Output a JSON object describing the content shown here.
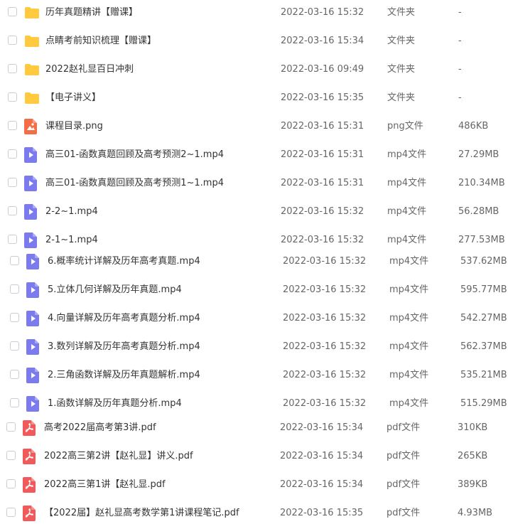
{
  "colors": {
    "folder": "#FFC940",
    "image_file": "#F36E47",
    "video_file": "#7B7BEF",
    "pdf_file": "#F05A5A",
    "checkbox_border": "#C9CDD4",
    "text_primary": "#333333",
    "text_secondary": "#666666"
  },
  "files": [
    {
      "icon": "folder-icon",
      "name": "历年真题精讲【赠课】",
      "date": "2022-03-16 15:32",
      "type": "文件夹",
      "size": "-"
    },
    {
      "icon": "folder-icon",
      "name": "点睛考前知识梳理【赠课】",
      "date": "2022-03-16 15:34",
      "type": "文件夹",
      "size": "-"
    },
    {
      "icon": "folder-icon",
      "name": "2022赵礼显百日冲刺",
      "date": "2022-03-16 09:49",
      "type": "文件夹",
      "size": "-"
    },
    {
      "icon": "folder-icon",
      "name": "【电子讲义】",
      "date": "2022-03-16 15:35",
      "type": "文件夹",
      "size": "-"
    },
    {
      "icon": "image-file-icon",
      "name": "课程目录.png",
      "date": "2022-03-16 15:31",
      "type": "png文件",
      "size": "486KB"
    },
    {
      "icon": "video-file-icon",
      "name": "高三01-函数真题回顾及高考预测2~1.mp4",
      "date": "2022-03-16 15:31",
      "type": "mp4文件",
      "size": "27.29MB"
    },
    {
      "icon": "video-file-icon",
      "name": "高三01-函数真题回顾及高考预测1~1.mp4",
      "date": "2022-03-16 15:31",
      "type": "mp4文件",
      "size": "210.34MB"
    },
    {
      "icon": "video-file-icon",
      "name": "2-2~1.mp4",
      "date": "2022-03-16 15:32",
      "type": "mp4文件",
      "size": "56.28MB"
    },
    {
      "icon": "video-file-icon",
      "name": "2-1~1.mp4",
      "date": "2022-03-16 15:32",
      "type": "mp4文件",
      "size": "277.53MB"
    },
    {
      "icon": "video-file-icon",
      "name": "6.概率统计详解及历年高考真题.mp4",
      "date": "2022-03-16 15:32",
      "type": "mp4文件",
      "size": "537.62MB"
    },
    {
      "icon": "video-file-icon",
      "name": "5.立体几何详解及历年真题.mp4",
      "date": "2022-03-16 15:32",
      "type": "mp4文件",
      "size": "595.77MB"
    },
    {
      "icon": "video-file-icon",
      "name": "4.向量详解及历年高考真题分析.mp4",
      "date": "2022-03-16 15:32",
      "type": "mp4文件",
      "size": "542.27MB"
    },
    {
      "icon": "video-file-icon",
      "name": "3.数列详解及历年高考真题分析.mp4",
      "date": "2022-03-16 15:32",
      "type": "mp4文件",
      "size": "562.37MB"
    },
    {
      "icon": "video-file-icon",
      "name": "2.三角函数详解及历年真题解析.mp4",
      "date": "2022-03-16 15:32",
      "type": "mp4文件",
      "size": "535.21MB"
    },
    {
      "icon": "video-file-icon",
      "name": "1.函数详解及历年真题分析.mp4",
      "date": "2022-03-16 15:32",
      "type": "mp4文件",
      "size": "515.29MB"
    },
    {
      "icon": "pdf-file-icon",
      "name": "高考2022届高考第3讲.pdf",
      "date": "2022-03-16 15:34",
      "type": "pdf文件",
      "size": "310KB"
    },
    {
      "icon": "pdf-file-icon",
      "name": "2022高三第2讲【赵礼显】讲义.pdf",
      "date": "2022-03-16 15:34",
      "type": "pdf文件",
      "size": "265KB"
    },
    {
      "icon": "pdf-file-icon",
      "name": "2022高三第1讲【赵礼显.pdf",
      "date": "2022-03-16 15:34",
      "type": "pdf文件",
      "size": "389KB"
    },
    {
      "icon": "pdf-file-icon",
      "name": "【2022届】赵礼显高考数学第1讲课程笔记.pdf",
      "date": "2022-03-16 15:35",
      "type": "pdf文件",
      "size": "4.93MB"
    }
  ]
}
